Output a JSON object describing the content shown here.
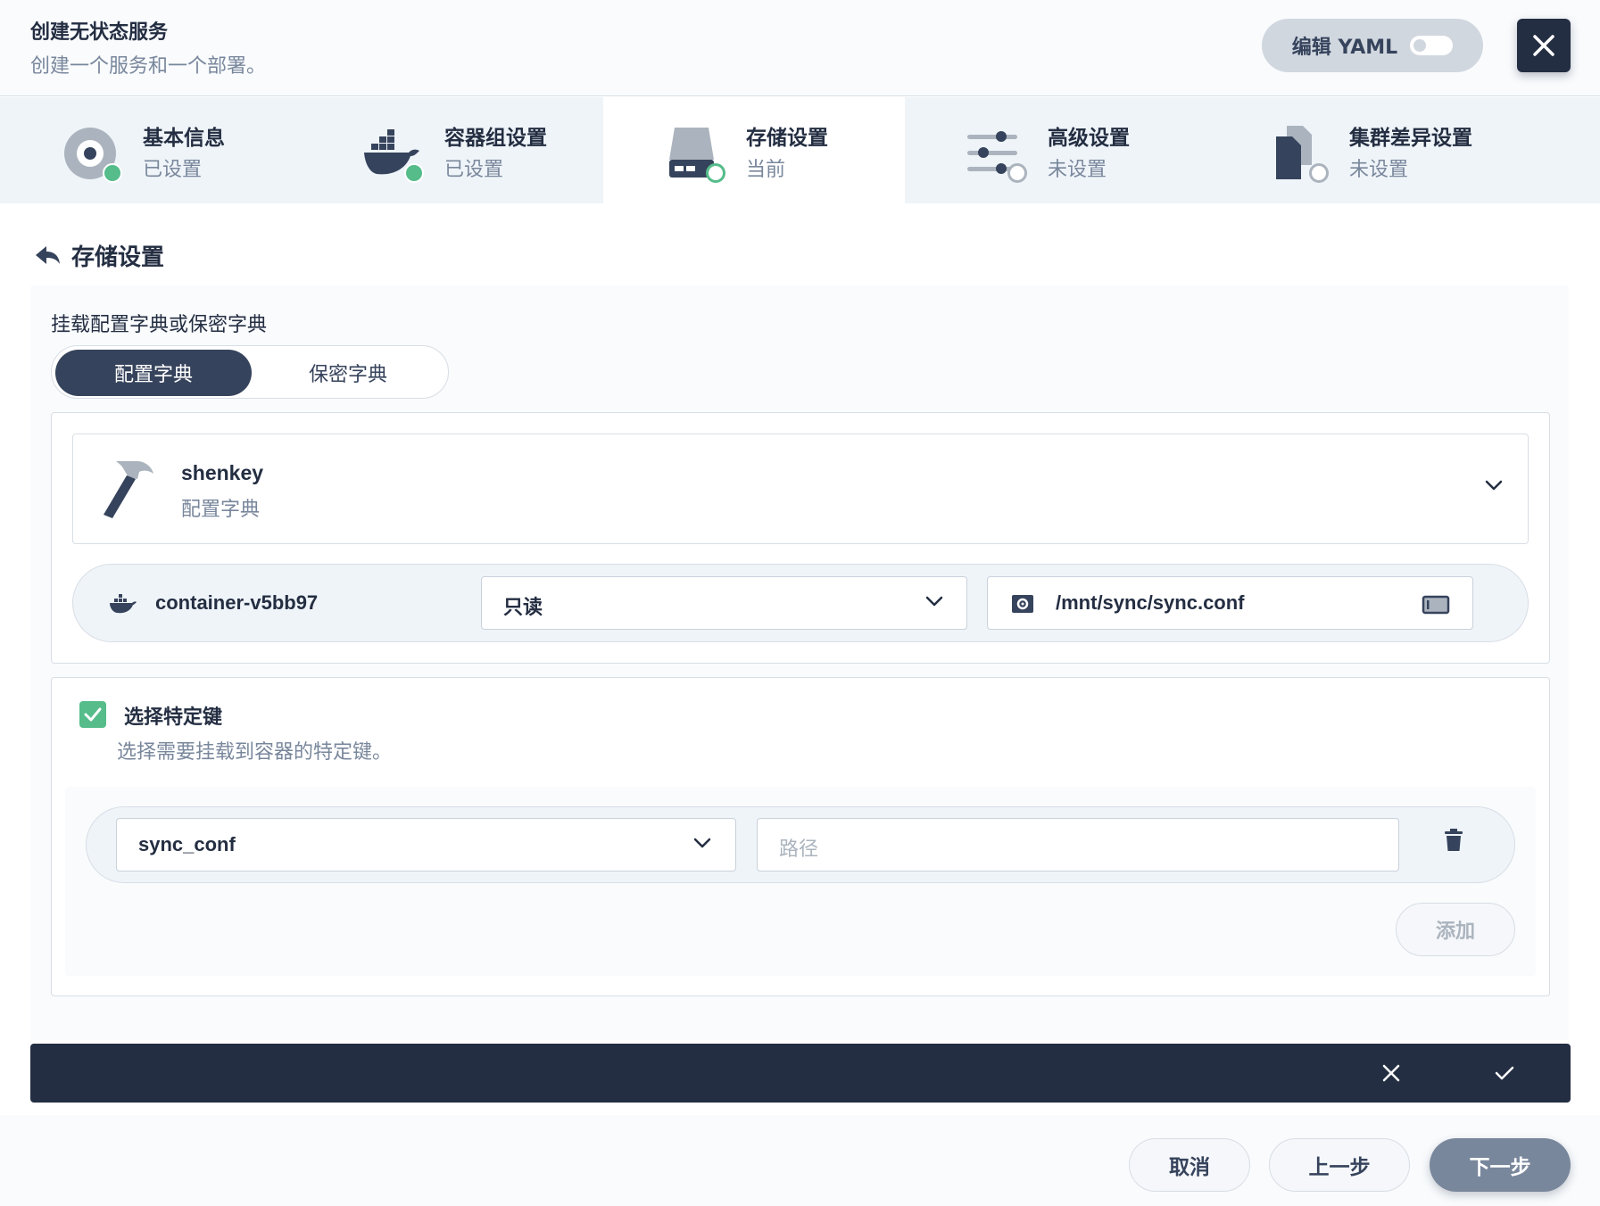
{
  "header": {
    "title": "创建无状态服务",
    "subtitle": "创建一个服务和一个部署。",
    "yaml_label": "编辑 YAML"
  },
  "steps": [
    {
      "name": "基本信息",
      "state": "已设置",
      "icon": "disk-icon"
    },
    {
      "name": "容器组设置",
      "state": "已设置",
      "icon": "docker-icon"
    },
    {
      "name": "存储设置",
      "state": "当前",
      "icon": "storage-icon"
    },
    {
      "name": "高级设置",
      "state": "未设置",
      "icon": "sliders-icon"
    },
    {
      "name": "集群差异设置",
      "state": "未设置",
      "icon": "files-icon"
    }
  ],
  "section": {
    "title": "存储设置"
  },
  "mount": {
    "label": "挂载配置字典或保密字典",
    "tabs": [
      "配置字典",
      "保密字典"
    ],
    "config": {
      "name": "shenkey",
      "type": "配置字典"
    },
    "container": "container-v5bb97",
    "access_mode": "只读",
    "mount_path": "/mnt/sync/sync.conf"
  },
  "keys": {
    "checkbox_label": "选择特定键",
    "checkbox_desc": "选择需要挂载到容器的特定键。",
    "key_value": "sync_conf",
    "path_placeholder": "路径",
    "add_label": "添加"
  },
  "footer": {
    "cancel": "取消",
    "prev": "上一步",
    "next": "下一步"
  },
  "colors": {
    "primary_dark": "#242e42",
    "success": "#55bc8a",
    "muted": "#79879c"
  }
}
